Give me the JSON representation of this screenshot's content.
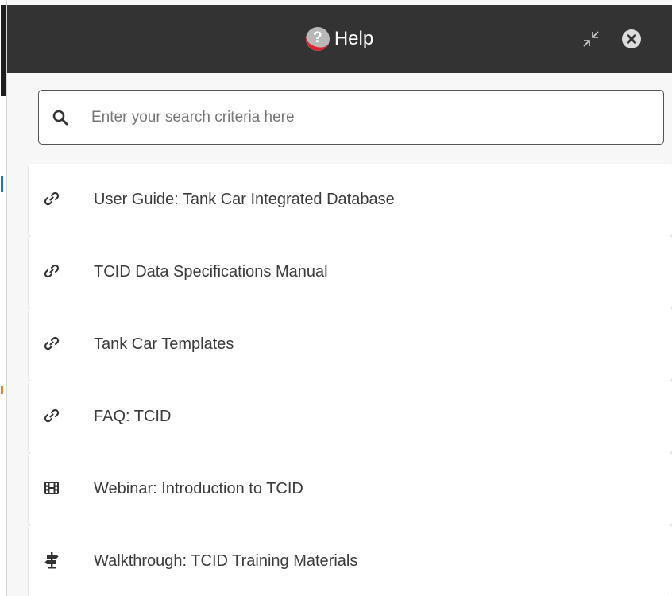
{
  "header": {
    "title": "Help",
    "help_icon_glyph": "?",
    "collapse_icon": "collapse-arrows-icon",
    "close_icon": "close-circle-icon"
  },
  "search": {
    "placeholder": "Enter your search criteria here",
    "value": ""
  },
  "items": [
    {
      "label": "User Guide: Tank Car Integrated Database",
      "icon": "link-icon"
    },
    {
      "label": "TCID Data Specifications Manual",
      "icon": "link-icon"
    },
    {
      "label": "Tank Car Templates",
      "icon": "link-icon"
    },
    {
      "label": "FAQ: TCID",
      "icon": "link-icon"
    },
    {
      "label": "Webinar: Introduction to TCID",
      "icon": "film-icon"
    },
    {
      "label": "Walkthrough: TCID Training Materials",
      "icon": "signpost-icon"
    }
  ],
  "colors": {
    "header_bg": "#333333",
    "panel_bg": "#f7f7f7",
    "accent_red": "#d8262f"
  }
}
